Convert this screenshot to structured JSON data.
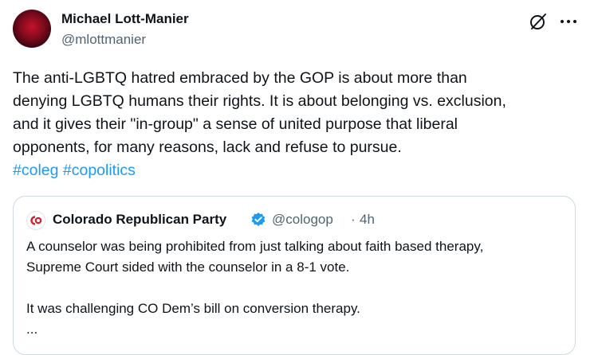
{
  "author": {
    "name": "Michael Lott-Manier",
    "handle": "@mlottmanier"
  },
  "tweet": {
    "lines": [
      "The anti-LGBTQ hatred embraced by the GOP is about more than",
      "denying LGBTQ humans their rights. It is about belonging vs. exclusion,",
      "and it gives their \"in-group\" a sense of united purpose that liberal",
      "opponents, for many reasons, lack and refuse to pursue."
    ],
    "hashtags": [
      "#coleg",
      "#copolitics"
    ]
  },
  "quoted_tweet": {
    "name": "Colorado Republican Party",
    "handle": "@cologop",
    "separator": "·",
    "time": "4h",
    "avatar_text": "CO",
    "lines": [
      "A counselor was being prohibited from just talking about faith based therapy,",
      "Supreme Court sided with the counselor in a 8-1 vote.",
      "",
      "It was challenging CO Dem’s bill on conversion therapy.",
      "..."
    ]
  },
  "icons": {
    "grok": "grok-icon",
    "more": "more-icon",
    "verified": "verified-icon"
  },
  "colors": {
    "link": "#1d9bf0",
    "muted": "#536471",
    "text": "#0f1419",
    "border": "#cfd9de",
    "brand_red": "#d4202c"
  }
}
